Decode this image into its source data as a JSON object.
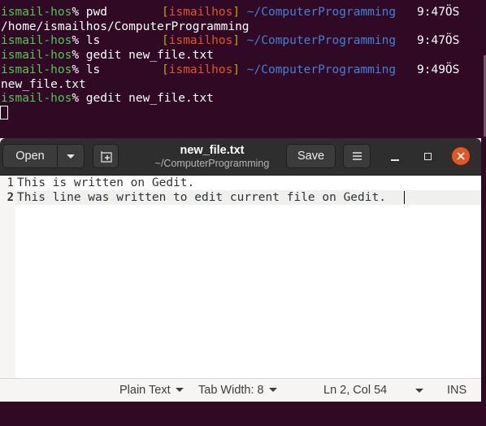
{
  "terminal": {
    "lines": [
      {
        "user": "ismail-hos",
        "pct": "%",
        "cmd": " pwd",
        "rp_open": "[",
        "rp_host": "ismailhos",
        "rp_close": "]",
        "rp_path": " ~/ComputerProgramming",
        "rp_time": "9:47ÖS"
      },
      {
        "output": "/home/ismailhos/ComputerProgramming"
      },
      {
        "user": "ismail-hos",
        "pct": "%",
        "cmd": " ls",
        "rp_open": "[",
        "rp_host": "ismailhos",
        "rp_close": "]",
        "rp_path": " ~/ComputerProgramming",
        "rp_time": "9:47ÖS"
      },
      {
        "user": "ismail-hos",
        "pct": "%",
        "cmd": " gedit new_file.txt"
      },
      {
        "user": "ismail-hos",
        "pct": "%",
        "cmd": " ls",
        "rp_open": "[",
        "rp_host": "ismailhos",
        "rp_close": "]",
        "rp_path": " ~/ComputerProgramming",
        "rp_time": "9:49ÖS"
      },
      {
        "output": "new_file.txt"
      },
      {
        "user": "ismail-hos",
        "pct": "%",
        "cmd": " gedit new_file.txt"
      }
    ]
  },
  "gedit": {
    "open_label": "Open",
    "save_label": "Save",
    "title": "new_file.txt",
    "subtitle": "~/ComputerProgramming",
    "lines": [
      {
        "num": "1",
        "text": "This is written on Gedit."
      },
      {
        "num": "2",
        "text": "This line was written to edit current file on Gedit."
      }
    ],
    "status": {
      "language": "Plain Text",
      "tab_width": "Tab Width: 8",
      "position": "Ln 2, Col 54",
      "mode": "INS"
    }
  },
  "colors": {
    "terminal_bg": "#300a24",
    "prompt_user": "#4ec94e",
    "accent_close": "#e95420"
  },
  "icons": [
    "chevron-down-icon",
    "new-tab-icon",
    "hamburger-menu-icon",
    "minimize-icon",
    "maximize-icon",
    "close-icon"
  ]
}
